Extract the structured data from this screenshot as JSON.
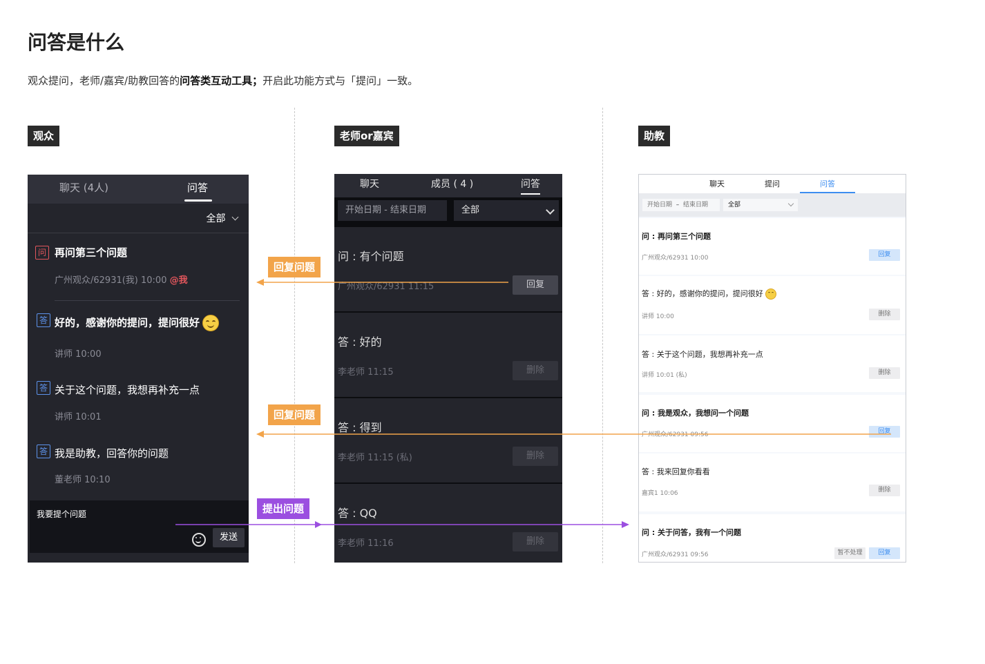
{
  "page": {
    "title": "问答是什么",
    "intro_before": "观众提问，老师/嘉宾/助教回答的",
    "intro_bold": "问答类互动工具；",
    "intro_after": "开启此功能方式与「提问」一致。"
  },
  "sections": {
    "audience": "观众",
    "teacher": "老师or嘉宾",
    "assistant": "助教"
  },
  "callouts": {
    "reply1": "回复问题",
    "reply2": "回复问题",
    "ask": "提出问题"
  },
  "audience_panel": {
    "tabs": [
      "聊天 (4人)",
      "问答"
    ],
    "filter": "全部",
    "items": [
      {
        "badge": "问",
        "text": "再问第三个问题",
        "meta": "广州观众/62931(我)  10:00",
        "mention": "@我"
      },
      {
        "badge": "答",
        "text": "好的，感谢你的提问，提问很好",
        "meta": "讲师   10:00"
      },
      {
        "badge": "答",
        "text": "关于这个问题，我想再补充一点",
        "meta": "讲师   10:01"
      },
      {
        "badge": "答",
        "text": "我是助教，回答你的问题",
        "meta": "董老师   10:10"
      }
    ],
    "input_placeholder": "我要提个问题",
    "send_label": "发送"
  },
  "teacher_panel": {
    "tabs": [
      "聊天",
      "成员 ( 4 )",
      "问答"
    ],
    "date_range": "开始日期   -   结束日期",
    "filter": "全部",
    "cards": [
      {
        "text": "问 : 有个问题",
        "meta": "广州观众/62931 11:15",
        "button": "回复"
      },
      {
        "text": "答 : 好的",
        "meta": "李老师 11:15",
        "button": "删除"
      },
      {
        "text": "答 : 得到",
        "meta": "李老师 11:15 (私)",
        "button": "删除"
      },
      {
        "text": "答 : QQ",
        "meta": "李老师 11:16",
        "button": "删除"
      }
    ]
  },
  "assistant_panel": {
    "tabs": [
      "聊天",
      "提问",
      "问答"
    ],
    "date_start": "开始日期",
    "date_sep": "–",
    "date_end": "结束日期",
    "filter": "全部",
    "cards": [
      {
        "text": "问 : 再问第三个问题",
        "meta": "广州观众/62931 10:00",
        "button": "回复"
      },
      {
        "text": "答 : 好的，感谢你的提问，提问很好",
        "meta": "讲师 10:00",
        "button": "删除"
      },
      {
        "text": "答 : 关于这个问题，我想再补充一点",
        "meta": "讲师 10:01 (私)",
        "button": "删除"
      },
      {
        "text": "问 : 我是观众，我想问一个问题",
        "meta": "广州观众/62931 09:56",
        "button": "回复"
      },
      {
        "text": "答 : 我来回复你看看",
        "meta": "嘉宾1 10:06",
        "button": "删除"
      },
      {
        "text": "问 : 关于问答，我有一个问题",
        "meta": "广州观众/62931 09:56",
        "button": "回复",
        "button2": "暂不处理"
      }
    ]
  },
  "colors": {
    "orange": "#f2a44a",
    "purple": "#9b4fe0",
    "blue": "#3c8df0",
    "red": "#e2565c"
  }
}
